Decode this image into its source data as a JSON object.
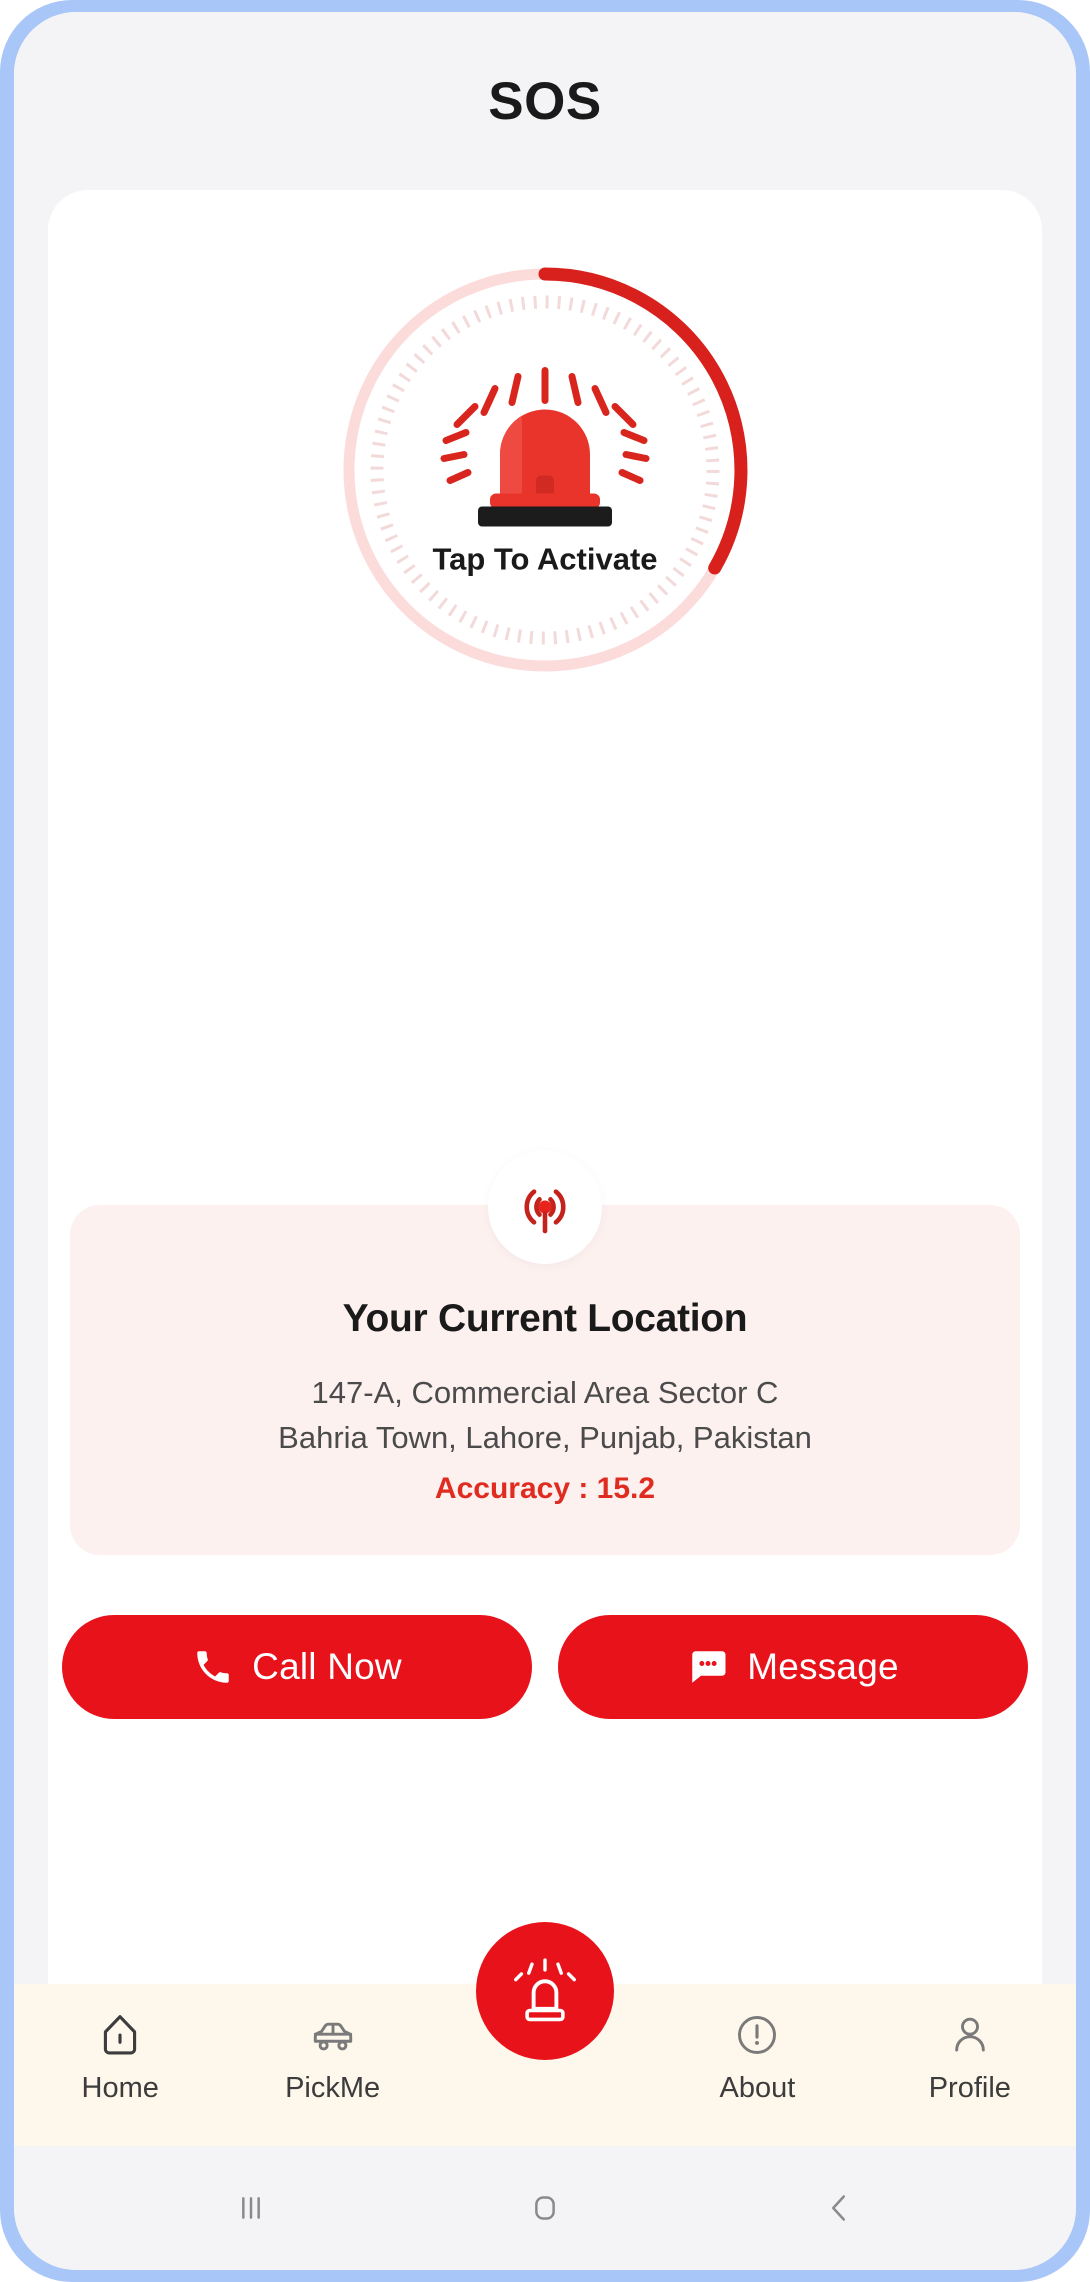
{
  "header": {
    "title": "SOS"
  },
  "sos_dial": {
    "activate_label": "Tap To Activate",
    "progress_percent": 33,
    "track_color": "#FBDCDB",
    "arc_color": "#D8211C",
    "siren_icon": "siren-icon"
  },
  "broadcast": {
    "icon": "broadcast-signal-icon"
  },
  "location": {
    "title": "Your Current Location",
    "address_line1": "147-A, Commercial Area Sector C",
    "address_line2": "Bahria Town, Lahore, Punjab, Pakistan",
    "accuracy": "Accuracy : 15.2",
    "accuracy_color": "#E02B20",
    "card_color": "#FDF1F0"
  },
  "actions": {
    "call": {
      "label": "Call Now",
      "icon": "phone-icon"
    },
    "message": {
      "label": "Message",
      "icon": "chat-bubble-icon"
    },
    "button_color": "#E8121B"
  },
  "bottom_nav": {
    "items": [
      {
        "label": "Home",
        "icon": "home-icon"
      },
      {
        "label": "PickMe",
        "icon": "car-icon"
      },
      {
        "label": "About",
        "icon": "info-circle-icon"
      },
      {
        "label": "Profile",
        "icon": "person-icon"
      }
    ],
    "fab": {
      "icon": "siren-icon",
      "color": "#E8121B"
    },
    "background": "#FDF8EB"
  },
  "system_bar": {
    "recents": "recents-icon",
    "home": "home-square-icon",
    "back": "back-chevron-icon"
  }
}
